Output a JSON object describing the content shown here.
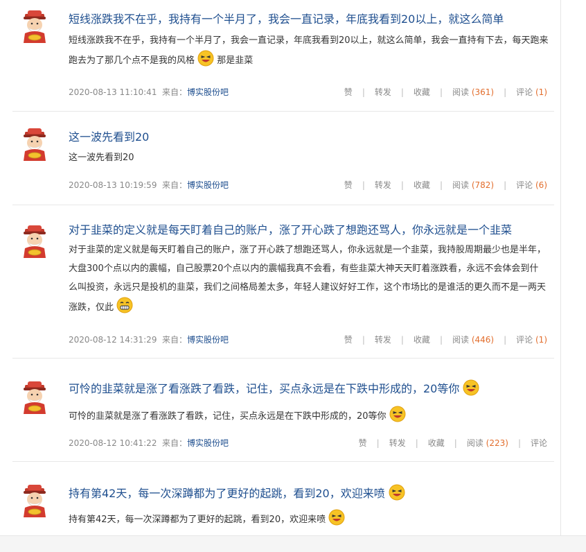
{
  "posts": [
    {
      "title": "短线涨跌我不在乎，我持有一个半月了，我会一直记录，年底我看到20以上，就这么简单",
      "body": "短线涨跌我不在乎，我持有一个半月了，我会一直记录，年底我看到20以上，就这么简单，我会一直持有下去，每天跑来跑去为了那几个点不是我的风格",
      "body_tail": "那是韭菜",
      "date": "2020-08-13 11:10:41",
      "source_label": "来自：",
      "forum": "博实股份吧",
      "like": "赞",
      "forward": "转发",
      "fav": "收藏",
      "read": "阅读",
      "read_count": "(361)",
      "comment": "评论",
      "comment_count": "(1)"
    },
    {
      "title": "这一波先看到20",
      "body": "这一波先看到20",
      "date": "2020-08-13 10:19:59",
      "source_label": "来自：",
      "forum": "博实股份吧",
      "like": "赞",
      "forward": "转发",
      "fav": "收藏",
      "read": "阅读",
      "read_count": "(782)",
      "comment": "评论",
      "comment_count": "(6)"
    },
    {
      "title": "对于韭菜的定义就是每天盯着自己的账户，涨了开心跌了想跑还骂人，你永远就是一个韭菜",
      "body": "对于韭菜的定义就是每天盯着自己的账户，涨了开心跌了想跑还骂人，你永远就是一个韭菜，我持股周期最少也是半年，大盘300个点以内的震幅，自己股票20个点以内的震幅我真不会看，有些韭菜大神天天盯着涨跌看，永远不会体会到什么叫投资，永远只是投机的韭菜，我们之间格局差太多，年轻人建议好好工作，这个市场比的是谁活的更久而不是一两天涨跌，仅此",
      "date": "2020-08-12 14:31:29",
      "source_label": "来自：",
      "forum": "博实股份吧",
      "like": "赞",
      "forward": "转发",
      "fav": "收藏",
      "read": "阅读",
      "read_count": "(446)",
      "comment": "评论",
      "comment_count": "(1)"
    },
    {
      "title": "可怜的韭菜就是涨了看涨跌了看跌，记住，买点永远是在下跌中形成的，20等你",
      "body": "可怜的韭菜就是涨了看涨跌了看跌，记住，买点永远是在下跌中形成的，20等你",
      "date": "2020-08-12 10:41:22",
      "source_label": "来自：",
      "forum": "博实股份吧",
      "like": "赞",
      "forward": "转发",
      "fav": "收藏",
      "read": "阅读",
      "read_count": "(223)",
      "comment": "评论"
    },
    {
      "title": "持有第42天，每一次深蹲都为了更好的起跳，看到20，欢迎来喷",
      "body": "持有第42天，每一次深蹲都为了更好的起跳，看到20，欢迎来喷"
    }
  ],
  "icons": {
    "avatar": "fortune-god-avatar-icon",
    "laugh": "laughing-emoji-icon",
    "grin": "grinning-emoji-icon"
  },
  "colors": {
    "title": "#1f4f8f",
    "count": "#e26d2c",
    "meta": "#888888"
  }
}
